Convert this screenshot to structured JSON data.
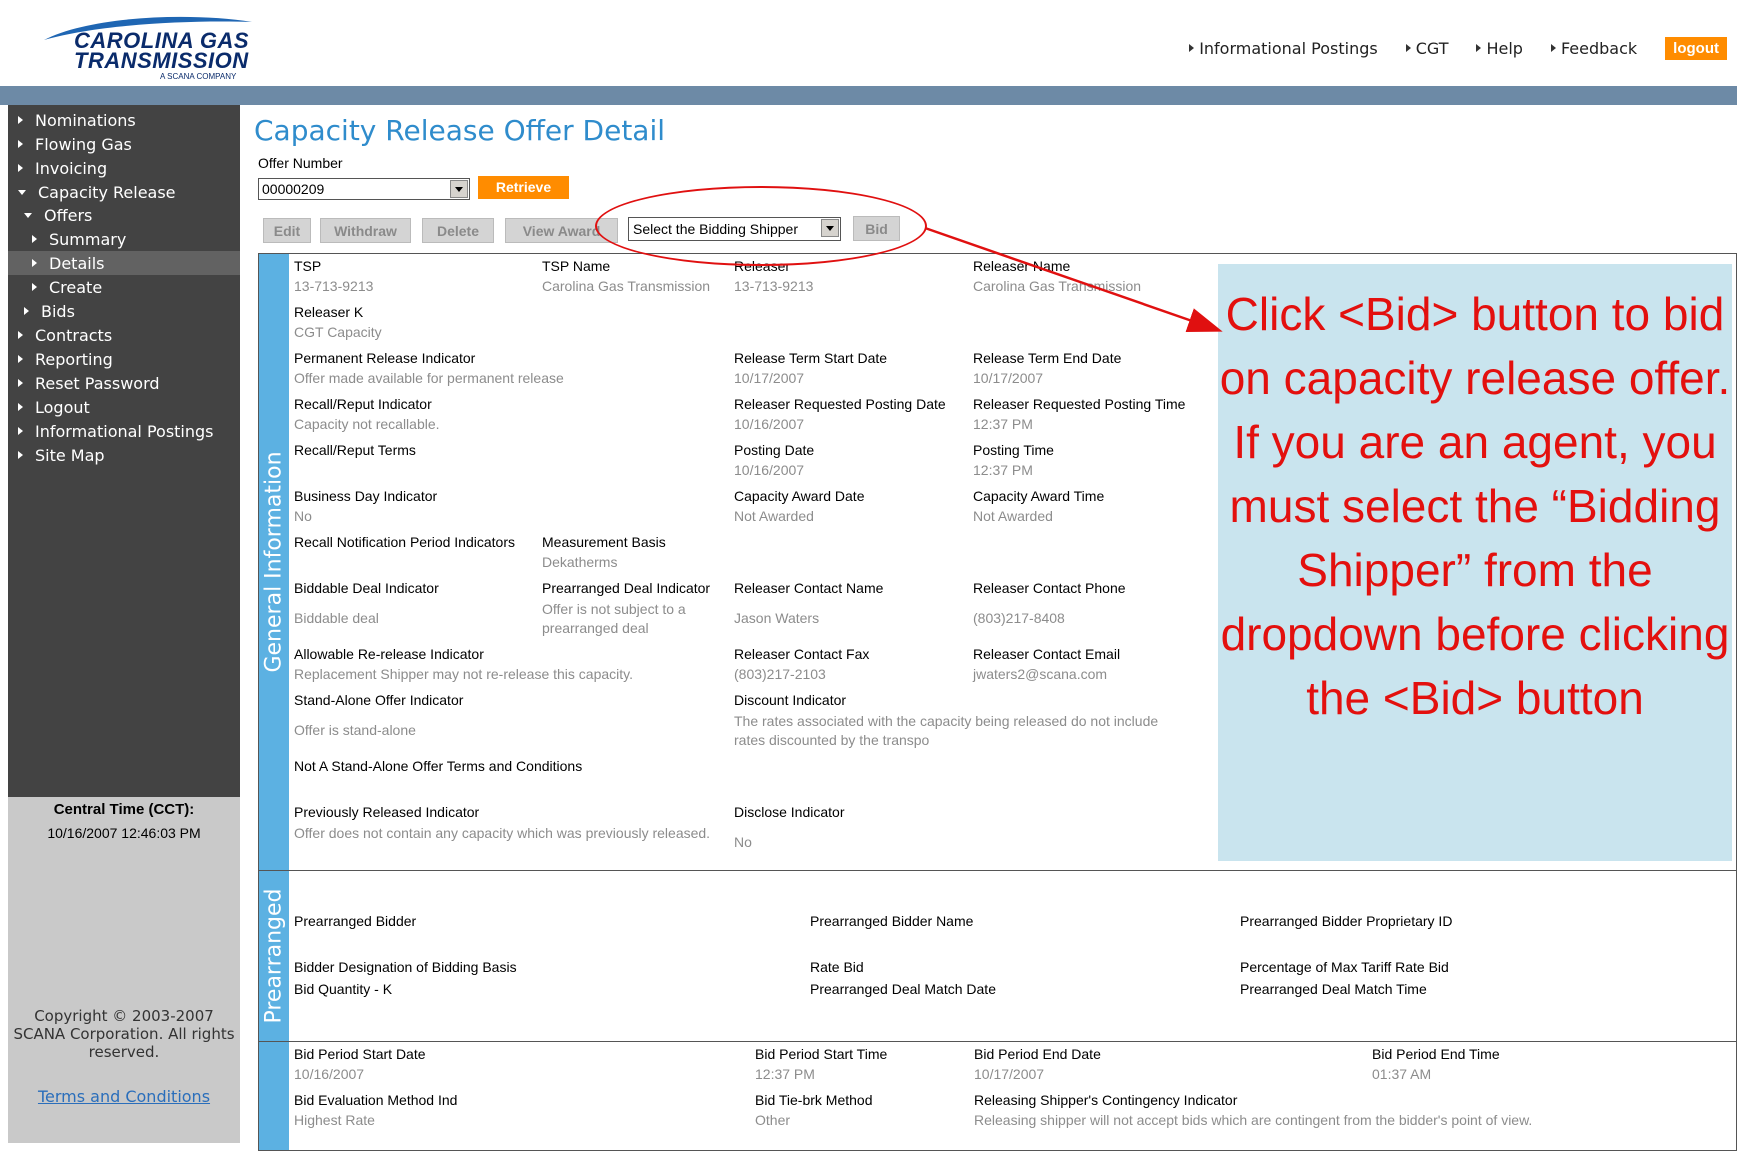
{
  "header": {
    "logo_line1": "CAROLINA GAS",
    "logo_line2": "TRANSMISSION",
    "logo_sub": "A SCANA COMPANY",
    "nav": [
      "Informational Postings",
      "CGT",
      "Help",
      "Feedback"
    ],
    "logout_label": "logout"
  },
  "sidebar": {
    "items": [
      "Nominations",
      "Flowing Gas",
      "Invoicing",
      "Capacity Release",
      "Offers",
      "Summary",
      "Details",
      "Create",
      "Bids",
      "Contracts",
      "Reporting",
      "Reset Password",
      "Logout",
      "Informational Postings",
      "Site Map"
    ],
    "time_label": "Central Time (CCT):",
    "time_value": "10/16/2007 12:46:03 PM",
    "copyright": "Copyright © 2003-2007 SCANA Corporation. All rights reserved.",
    "terms_label": "Terms and Conditions"
  },
  "page": {
    "title": "Capacity Release Offer Detail",
    "offer_label": "Offer Number",
    "offer_value": "00000209",
    "retrieve_label": "Retrieve",
    "buttons": {
      "edit": "Edit",
      "withdraw": "Withdraw",
      "delete": "Delete",
      "view_award": "View Award",
      "bid": "Bid"
    },
    "shipper_select_value": "Select the Bidding Shipper"
  },
  "general": {
    "tab_label": "General Information",
    "tsp_l": "TSP",
    "tsp_v": "13-713-9213",
    "tspname_l": "TSP Name",
    "tspname_v": "Carolina Gas Transmission",
    "releaser_l": "Releaser",
    "releaser_v": "13-713-9213",
    "releasername_l": "Releaser Name",
    "releasername_v": "Carolina Gas Transmission",
    "releaserk_l": "Releaser K",
    "releaserk_v": "CGT Capacity",
    "perm_l": "Permanent Release Indicator",
    "perm_v": "Offer made available for permanent release",
    "rts_l": "Release Term Start Date",
    "rts_v": "10/17/2007",
    "rte_l": "Release Term End Date",
    "rte_v": "10/17/2007",
    "recall_l": "Recall/Reput Indicator",
    "recall_v": "Capacity not recallable.",
    "rrpd_l": "Releaser Requested Posting Date",
    "rrpd_v": "10/16/2007",
    "rrpt_l": "Releaser Requested Posting Time",
    "rrpt_v": "12:37 PM",
    "recallterms_l": "Recall/Reput Terms",
    "pd_l": "Posting Date",
    "pd_v": "10/16/2007",
    "pt_l": "Posting Time",
    "pt_v": "12:37 PM",
    "bdi_l": "Business Day Indicator",
    "bdi_v": "No",
    "cad_l": "Capacity Award Date",
    "cad_v": "Not Awarded",
    "cat_l": "Capacity Award Time",
    "cat_v": "Not Awarded",
    "rnpi_l": "Recall Notification Period Indicators",
    "mb_l": "Measurement Basis",
    "mb_v": "Dekatherms",
    "bdeal_l": "Biddable Deal Indicator",
    "bdeal_v": "Biddable deal",
    "pdeal_l": "Prearranged Deal Indicator",
    "pdeal_v": "Offer is not subject to a prearranged deal",
    "rcn_l": "Releaser Contact Name",
    "rcn_v": "Jason Waters",
    "rcp_l": "Releaser Contact Phone",
    "rcp_v": "(803)217-8408",
    "arr_l": "Allowable Re-release Indicator",
    "arr_v": "Replacement Shipper may not re-release this capacity.",
    "rcf_l": "Releaser Contact Fax",
    "rcf_v": "(803)217-2103",
    "rce_l": "Releaser Contact Email",
    "rce_v": "jwaters2@scana.com",
    "sa_l": "Stand-Alone Offer Indicator",
    "sa_v": "Offer is stand-alone",
    "di_l": "Discount Indicator",
    "di_v": "The rates associated with the capacity being released do not include rates discounted by the transpo",
    "nsa_l": "Not A Stand-Alone Offer Terms and Conditions",
    "pri_l": "Previously Released Indicator",
    "pri_v": "Offer does not contain any capacity which was previously released.",
    "disc_l": "Disclose Indicator",
    "disc_v": "No"
  },
  "prearranged": {
    "tab_label": "Prearranged",
    "bidder_l": "Prearranged Bidder",
    "biddername_l": "Prearranged Bidder Name",
    "bidderid_l": "Prearranged Bidder Proprietary ID",
    "bdbb_l": "Bidder Designation of Bidding Basis",
    "ratebid_l": "Rate Bid",
    "pmtr_l": "Percentage of Max Tariff Rate Bid",
    "bqk_l": "Bid Quantity - K",
    "pdmd_l": "Prearranged Deal Match Date",
    "pdmt_l": "Prearranged Deal Match Time"
  },
  "bidperiod": {
    "bpsd_l": "Bid Period Start Date",
    "bpsd_v": "10/16/2007",
    "bpst_l": "Bid Period Start Time",
    "bpst_v": "12:37 PM",
    "bped_l": "Bid Period End Date",
    "bped_v": "10/17/2007",
    "bpet_l": "Bid Period End Time",
    "bpet_v": "01:37 AM",
    "bem_l": "Bid Evaluation Method Ind",
    "bem_v": "Highest Rate",
    "btb_l": "Bid Tie-brk Method",
    "btb_v": "Other",
    "rsci_l": "Releasing Shipper's Contingency Indicator",
    "rsci_v": "Releasing shipper will not accept bids which are contingent from the bidder's point of view."
  },
  "callout": {
    "text": "Click <Bid> button to bid on capacity release offer.  If you are an agent, you must select the “Bidding Shipper” from the dropdown before clicking the <Bid> button"
  },
  "colors": {
    "accent_orange": "#ff8c00",
    "title_blue": "#2f8ccc",
    "tab_blue": "#5cb1e2",
    "annotation_red": "#e3100e"
  }
}
